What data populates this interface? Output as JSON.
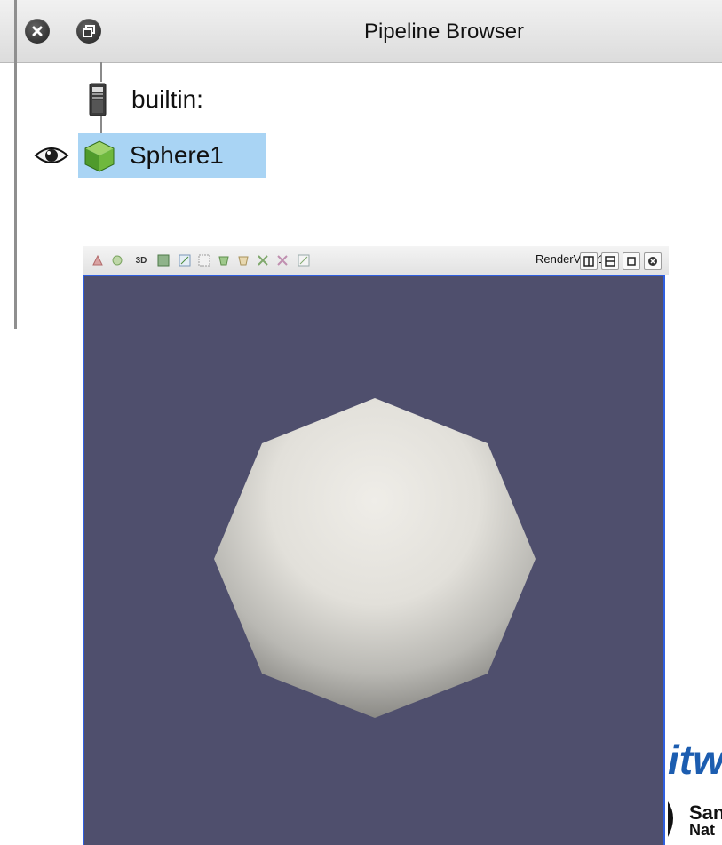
{
  "pipeline_browser": {
    "title": "Pipeline Browser",
    "items": [
      {
        "label": "builtin:",
        "icon": "server-icon"
      },
      {
        "label": "Sphere1",
        "icon": "green-cube-icon",
        "visible": true,
        "selected": true
      }
    ]
  },
  "render_view": {
    "name": "RenderView1",
    "toolbar_3d_label": "3D",
    "background_color": "#4f4f6d",
    "border_color": "#2f5fe0"
  },
  "logos": {
    "kitware_fragment": "itw",
    "sandia_fragment_1": "San",
    "sandia_fragment_2": "Nat"
  },
  "colors": {
    "selection": "#a9d4f4",
    "sphere_light": "#efede8",
    "sphere_dark": "#7d7c78"
  }
}
